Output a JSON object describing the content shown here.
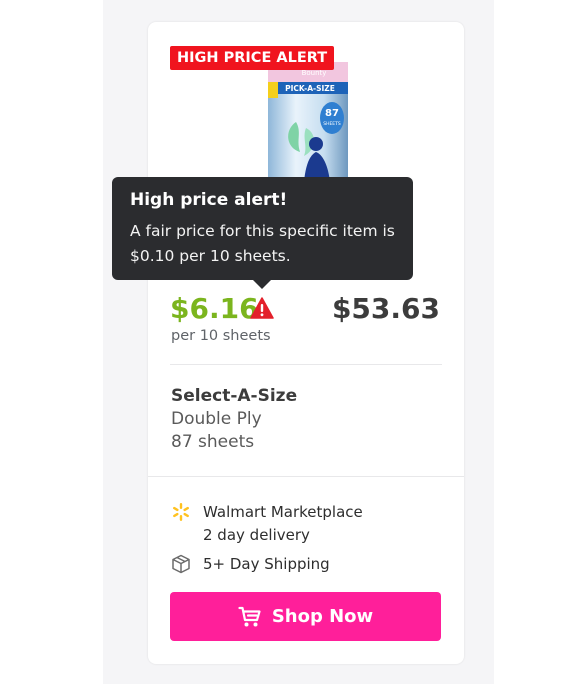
{
  "badge": {
    "label": "HIGH PRICE ALERT"
  },
  "tooltip": {
    "title": "High price alert!",
    "body": "A fair price for this specific item is $0.10 per 10 sheets."
  },
  "pricing": {
    "unit_price": "$6.16",
    "unit_label": "per 10 sheets",
    "total_price": "$53.63"
  },
  "product": {
    "name": "Select-A-Size",
    "ply": "Double Ply",
    "sheets": "87 sheets"
  },
  "product_image": {
    "lines": [
      "Bounty",
      "PICK-A-SIZE",
      "87",
      "SHEETS"
    ]
  },
  "delivery": {
    "seller": "Walmart Marketplace",
    "speed": "2 day delivery",
    "shipping": "5+ Day Shipping"
  },
  "cta": {
    "label": "Shop Now"
  },
  "icons": {
    "warning": "warning-triangle-icon",
    "walmart": "walmart-spark-icon",
    "shipping": "box-icon",
    "cart": "cart-icon"
  },
  "colors": {
    "badge": "#f0141e",
    "unit_price": "#7bb51e",
    "cta": "#ff1f9a",
    "tooltip": "#2b2c2f",
    "walmart_spark": "#ffc220"
  }
}
